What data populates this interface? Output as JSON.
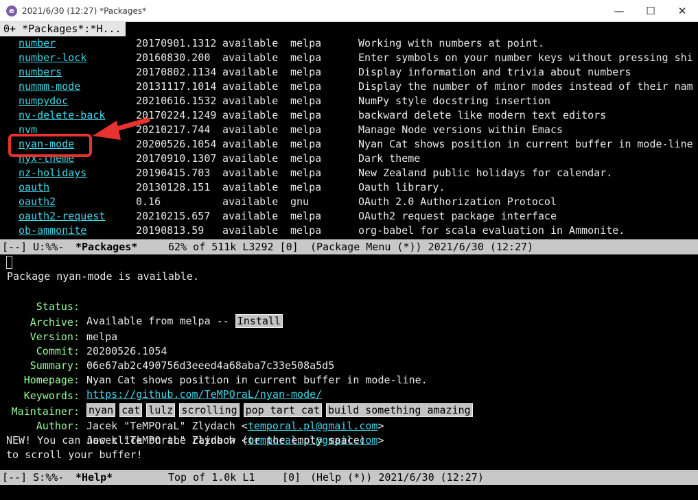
{
  "window": {
    "title": "2021/6/30 (12:27)  *Packages*"
  },
  "tabline": {
    "tab": "0+ *Packages*:*H..."
  },
  "packages": [
    {
      "name": "number",
      "version": "20170901.1312",
      "status": "available",
      "archive": "melpa",
      "desc": "Working with numbers at point."
    },
    {
      "name": "number-lock",
      "version": "20160830.200",
      "status": "available",
      "archive": "melpa",
      "desc": "Enter symbols on your number keys without pressing shi"
    },
    {
      "name": "numbers",
      "version": "20170802.1134",
      "status": "available",
      "archive": "melpa",
      "desc": "Display information and trivia about numbers"
    },
    {
      "name": "nummm-mode",
      "version": "20131117.1014",
      "status": "available",
      "archive": "melpa",
      "desc": "Display the number of minor modes instead of their nam"
    },
    {
      "name": "numpydoc",
      "version": "20210616.1532",
      "status": "available",
      "archive": "melpa",
      "desc": "NumPy style docstring insertion"
    },
    {
      "name": "nv-delete-back",
      "version": "20170224.1249",
      "status": "available",
      "archive": "melpa",
      "desc": "backward delete like modern text editors"
    },
    {
      "name": "nvm",
      "version": "20210217.744",
      "status": "available",
      "archive": "melpa",
      "desc": "Manage Node versions within Emacs"
    },
    {
      "name": "nyan-mode",
      "version": "20200526.1054",
      "status": "available",
      "archive": "melpa",
      "desc": "Nyan Cat shows position in current buffer in mode-line"
    },
    {
      "name": "nyx-theme",
      "version": "20170910.1307",
      "status": "available",
      "archive": "melpa",
      "desc": "Dark theme"
    },
    {
      "name": "nz-holidays",
      "version": "20190415.703",
      "status": "available",
      "archive": "melpa",
      "desc": "New Zealand public holidays for calendar."
    },
    {
      "name": "oauth",
      "version": "20130128.151",
      "status": "available",
      "archive": "melpa",
      "desc": "Oauth library."
    },
    {
      "name": "oauth2",
      "version": "0.16",
      "status": "available",
      "archive": "gnu",
      "desc": "OAuth 2.0 Authorization Protocol"
    },
    {
      "name": "oauth2-request",
      "version": "20210215.657",
      "status": "available",
      "archive": "melpa",
      "desc": "OAuth2 request package interface"
    },
    {
      "name": "ob-ammonite",
      "version": "20190813.59",
      "status": "available",
      "archive": "melpa",
      "desc": "org-babel for scala evaluation in Ammonite."
    }
  ],
  "modeline_packages": {
    "flags": "[--] U:%%-",
    "buffer": "*Packages*",
    "position": "62% of 511k L3292 [0]",
    "mode": "(Package Menu (*)) 2021/6/30 (12:27)"
  },
  "help": {
    "header_rest": "ackage nyan-mode is available.",
    "header_first": "P",
    "labels": {
      "status": "Status:",
      "archive": "Archive:",
      "version": "Version:",
      "commit": "Commit:",
      "summary": "Summary:",
      "homepage": "Homepage:",
      "keywords": "Keywords:",
      "maintainer": "Maintainer:",
      "author": "Author:"
    },
    "status_text": "Available from melpa --",
    "install_button": "Install",
    "archive": "melpa",
    "version": "20200526.1054",
    "commit": "06e67ab2c490756d3eeed4a68aba7c33e508a5d5",
    "summary": "Nyan Cat shows position in current buffer in mode-line.",
    "homepage": "https://github.com/TeMPOraL/nyan-mode/",
    "keywords": [
      "nyan",
      "cat",
      "lulz",
      "scrolling",
      "pop tart cat",
      "build something amazing"
    ],
    "maintainer_name": "Jacek \"TeMPOraL\" Zlydach <",
    "maintainer_email": "temporal.pl@gmail.com",
    "author_name": "Jacek \"TeMPOraL\" Zlydach <",
    "author_email": "temporal.pl@gmail.com",
    "angle_close": ">",
    "news_line1": "NEW! You can now click on the rainbow (or the empty space)",
    "news_line2": "to scroll your buffer!"
  },
  "modeline_help": {
    "flags": "[--] S:%%-",
    "buffer": "*Help*",
    "position": "Top of 1.0k L1",
    "count": "[0]",
    "mode": "(Help (*)) 2021/6/30 (12:27)"
  },
  "colors": {
    "link": "#3fd6e8",
    "label": "#98fb98",
    "annotation": "#e8322f"
  }
}
